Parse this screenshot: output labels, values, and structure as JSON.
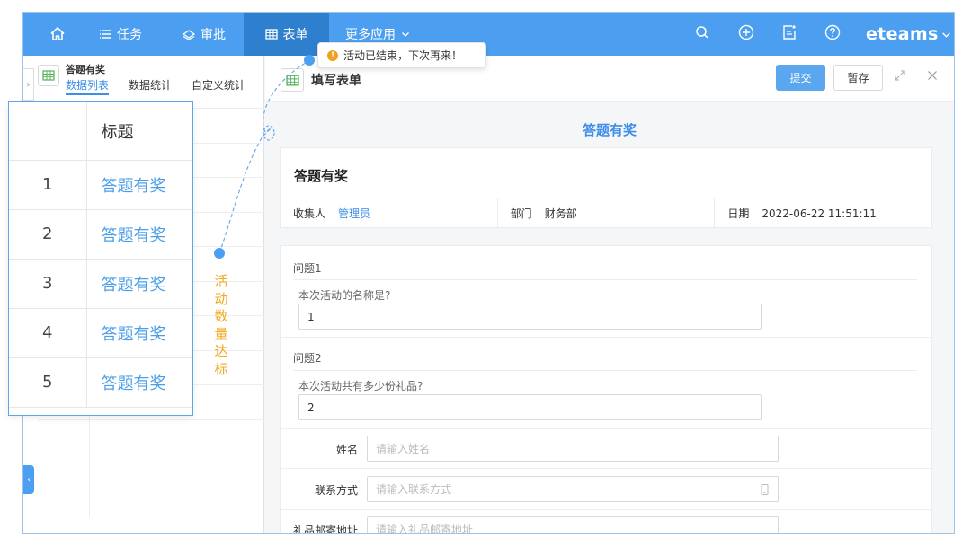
{
  "nav": {
    "items": [
      {
        "label": ""
      },
      {
        "label": "任务"
      },
      {
        "label": "审批"
      },
      {
        "label": "表单"
      },
      {
        "label": "更多应用"
      }
    ],
    "brand": "eteams",
    "colors": {
      "bar": "#4c9ff0",
      "active": "#2f7fcf"
    }
  },
  "toast": {
    "text": "活动已结束，下次再来！"
  },
  "left_panel": {
    "title": "答题有奖",
    "tabs": [
      "数据列表",
      "数据统计",
      "自定义统计"
    ]
  },
  "callout": {
    "header": {
      "index": "",
      "title": "标题"
    },
    "rows": [
      {
        "index": "1",
        "title": "答题有奖"
      },
      {
        "index": "2",
        "title": "答题有奖"
      },
      {
        "index": "3",
        "title": "答题有奖"
      },
      {
        "index": "4",
        "title": "答题有奖"
      },
      {
        "index": "5",
        "title": "答题有奖"
      }
    ],
    "annotation": [
      "活",
      "动",
      "数",
      "量",
      "达",
      "标"
    ]
  },
  "form": {
    "header_title": "填写表单",
    "submit_label": "提交",
    "draft_label": "暂存",
    "heading": "答题有奖",
    "card_title": "答题有奖",
    "meta": {
      "collector_label": "收集人",
      "collector_value": "管理员",
      "dept_label": "部门",
      "dept_value": "财务部",
      "date_label": "日期",
      "date_value": "2022-06-22 11:51:11"
    },
    "questions": [
      {
        "label": "问题1",
        "text": "本次活动的名称是?",
        "value": "1"
      },
      {
        "label": "问题2",
        "text": "本次活动共有多少份礼品?",
        "value": "2"
      }
    ],
    "fields": [
      {
        "label": "姓名",
        "placeholder": "请输入姓名"
      },
      {
        "label": "联系方式",
        "placeholder": "请输入联系方式"
      },
      {
        "label": "礼品邮寄地址",
        "placeholder": "请输入礼品邮寄地址"
      }
    ]
  }
}
